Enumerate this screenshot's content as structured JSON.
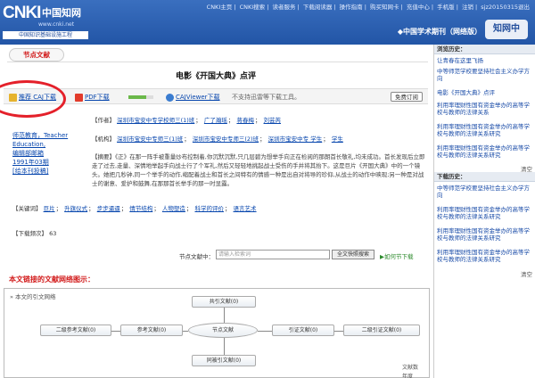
{
  "header": {
    "logo_text": "CNKI",
    "logo_cn": "中国知网",
    "logo_url": "www.cnki.net",
    "logo_sub": "中国知识基础设施工程",
    "top_links": [
      "CNKI主页",
      "CNKI搜索",
      "读者服务",
      "下载阅读器",
      "操作指南",
      "购买知网卡",
      "充值中心",
      "手机版",
      "注销",
      "sjz20150315退出"
    ],
    "journal_name": "◆中国学术期刊（网络版）",
    "journal_logo": "知网中"
  },
  "tab": {
    "node_tab": "节点文献"
  },
  "article": {
    "title": "电影《开国大典》点评"
  },
  "download": {
    "caj": "推荐 CAJ下载",
    "pdf": "PDF下载",
    "pdf_progress": 0.72,
    "viewer": "CAJViewer下载",
    "note": "不支持迅雷等下载工具。",
    "free_btn": "免费订阅"
  },
  "author_panel": {
    "name": "师范教育，Teacher Education,",
    "edit": "编辑部邮箱",
    "issue": "1991年03期",
    "add": "[给本刊投稿]"
  },
  "meta": {
    "author_label": "【作者】",
    "authors": [
      "深圳市宝安中专学校师三(1)班",
      "广了瀚瑶",
      "蒋春梅",
      "刘芸芮"
    ],
    "org_label": "【机构】",
    "orgs": [
      "深圳市宝安中专师三(1)班",
      "深圳市宝安中专师三(2)班",
      "深圳市宝安中专 学生",
      "学生"
    ],
    "abstract_label": "【摘要】",
    "abstract": "《正》在那一阵手被重量炒布控制着,你沉默沉默,只几层碧为想举手向正在检阅的那朗首长敬礼,均未成功。首长发现后立即走了过去,走量、深情地举起手向战士行了个军礼,然后又轻轻地挑起战士受伤的手并将其抬下。这是巨片《开国大典》中的一个镜头。她把几秒钟,同一个举手的动作,缩配着战士和首长之间特有的情感一种是出自对将导的珍仰,从战士的动作中映现;另一种是对战士的谢意、爱护和鼓舞,在那那首长举手的那一时显露。"
  },
  "keywords": {
    "label": "【关键词】",
    "items": [
      "巨片",
      "升旗仪式",
      "步步逼逼",
      "情节结构",
      "人物塑造",
      "科学的评价",
      "语言艺术"
    ]
  },
  "downloads": {
    "label": "【下载频次】",
    "count": "63"
  },
  "search": {
    "label": "节点文献中：",
    "placeholder": "请输入检索词",
    "button": "全文快照搜索",
    "node_dl": "▶如何节下载"
  },
  "network": {
    "title": "本文链接的文献网络图示：",
    "subtitle": "» 本文的引文网络",
    "cite_common": "共引文献(0)",
    "ref2": "二级参考文献(0)",
    "ref": "参考文献(0)",
    "node": "节点文献",
    "cite": "引证文献(0)",
    "cite2": "二级引证文献(0)",
    "cocite": "同被引文献(0)",
    "year_l": "文献数",
    "year_r": "年度"
  },
  "sidebar": {
    "history_head": "浏览历史：",
    "history_items": [
      "让青春在这里飞扬",
      "中等师范学校要坚持社会主义办学方向",
      "电影《开国大典》点评",
      "利用率理财性国有资金举办的高等学校与教师的法律关系",
      "利用率理财性国有资金举办的高等学校与教师的法律关系研究",
      "利用率理财性国有资金举办的高等学校与教师的法律关系研究"
    ],
    "close": "清空",
    "downloads_head": "下载历史：",
    "download_items": [
      "中等师范学校要坚持社会主义办学方向",
      "利用率理财性国有资金举办的高等学校与教师的法律关系研究",
      "利用率理财性国有资金举办的高等学校与教师的法律关系研究",
      "利用率理财性国有资金举办的高等学校与教师的法律关系研究"
    ]
  },
  "colors": {
    "header_blue": "#2255a6",
    "accent_red": "#d21b1b",
    "link": "#0645ad"
  }
}
